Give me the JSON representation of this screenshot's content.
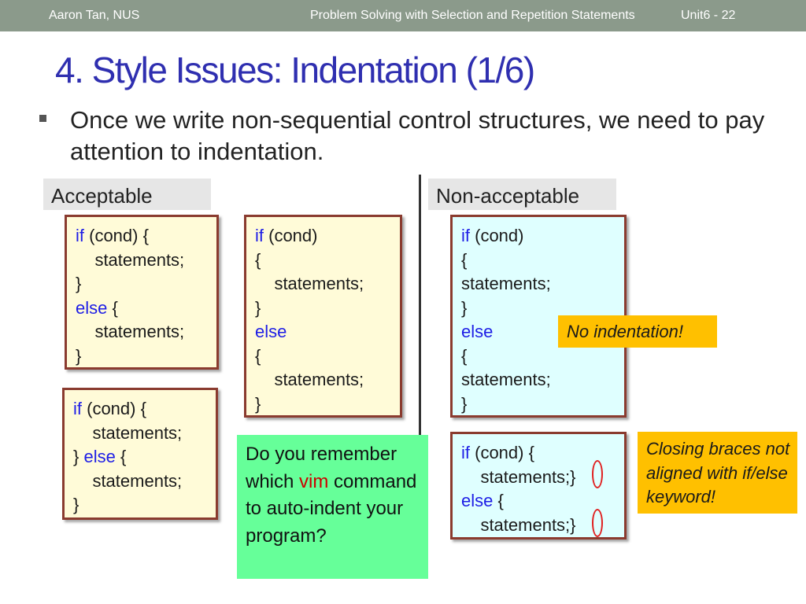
{
  "header": {
    "author": "Aaron Tan, NUS",
    "course_title": "Problem Solving with Selection and Repetition Statements",
    "page": "Unit6 - 22"
  },
  "slide": {
    "title": "4. Style Issues: Indentation (1/6)",
    "bullet": "Once we write non-sequential control structures, we need to pay attention to indentation."
  },
  "labels": {
    "acceptable": "Acceptable",
    "non_acceptable": "Non-acceptable"
  },
  "code": {
    "kw_if": "if",
    "kw_else": "else",
    "cond": " (cond)",
    "cond_brace": " (cond) {",
    "space_brace": " {",
    "open": "{",
    "close": "}",
    "close_else": "} ",
    "stmt": "statements;",
    "stmt_indented": "    statements;",
    "stmt_close": "    statements;}"
  },
  "notes": {
    "no_indentation": "No indentation!",
    "closing_braces": "Closing braces not aligned with if/else keyword!"
  },
  "question": {
    "part1": "Do you remember which ",
    "vim": "vim",
    "part2": " command to auto-indent your program?"
  },
  "colors": {
    "title": "#2f2fb0",
    "keyword": "#1e1ee6",
    "header_bar": "#8b9a8b",
    "box_border": "#8a3b2f",
    "note": "#ffc000",
    "question_box": "#66ff99"
  }
}
